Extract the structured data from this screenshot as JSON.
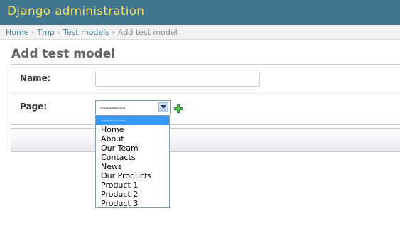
{
  "header": {
    "title": "Django administration"
  },
  "breadcrumbs": {
    "items": [
      "Home",
      "Tmp",
      "Test models",
      "Add test model"
    ],
    "separator": "›"
  },
  "page": {
    "title": "Add test model"
  },
  "form": {
    "name": {
      "label": "Name:",
      "value": ""
    },
    "page": {
      "label": "Page:",
      "selected": "---------",
      "options": [
        "---------",
        "Home",
        "About",
        "Our Team",
        "Contacts",
        "News",
        "Our Products",
        "Product 1",
        "Product 2",
        "Product 3"
      ]
    }
  },
  "colors": {
    "header_bg": "#417690",
    "title_text": "#f5dd5d",
    "link": "#447e9b",
    "selection": "#3399ff",
    "add_icon": "#2e9a2e"
  },
  "icons": {
    "dropdown_arrow": "chevron-down-icon",
    "add_related": "plus-icon"
  }
}
